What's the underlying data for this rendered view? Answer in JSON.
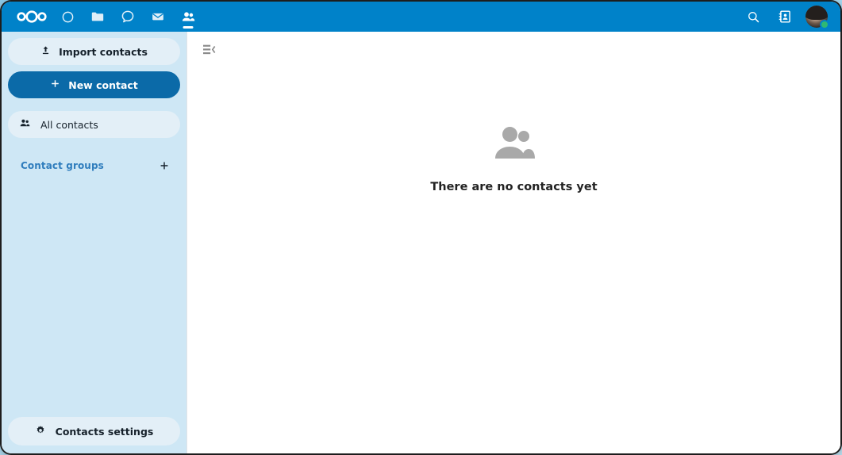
{
  "header": {
    "logo_name": "nextcloud-logo",
    "brand_color": "#0082c9",
    "apps": [
      {
        "name": "dashboard-icon",
        "label": "Dashboard"
      },
      {
        "name": "files-icon",
        "label": "Files"
      },
      {
        "name": "talk-icon",
        "label": "Talk"
      },
      {
        "name": "mail-icon",
        "label": "Mail"
      },
      {
        "name": "contacts-icon",
        "label": "Contacts",
        "active": true
      }
    ],
    "search_label": "Search",
    "contacts_menu_label": "Contacts",
    "avatar_label": "Settings",
    "status": "online"
  },
  "sidebar": {
    "import_label": "Import contacts",
    "new_contact_label": "New contact",
    "all_contacts_label": "All contacts",
    "contact_groups_label": "Contact groups",
    "add_group_label": "+",
    "settings_label": "Contacts settings"
  },
  "content": {
    "toggle_label": "Toggle contacts list",
    "empty_title": "There are no contacts yet"
  }
}
